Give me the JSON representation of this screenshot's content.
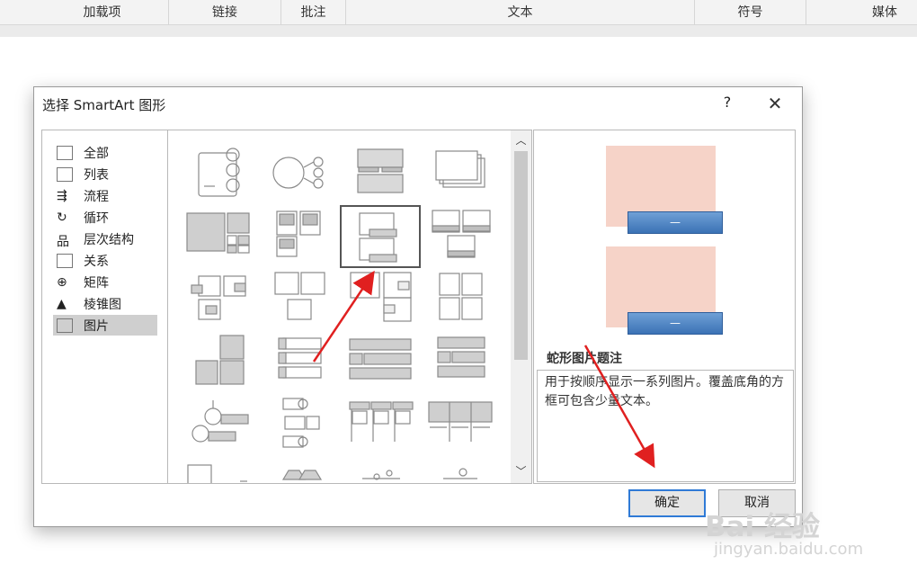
{
  "ribbon": {
    "groups": [
      "加载项",
      "链接",
      "批注",
      "文本",
      "符号",
      "媒体"
    ]
  },
  "dialog": {
    "title": "选择 SmartArt 图形",
    "help": "?",
    "close": "✕",
    "categories": [
      {
        "label": "全部",
        "icon": "all-icon"
      },
      {
        "label": "列表",
        "icon": "list-icon"
      },
      {
        "label": "流程",
        "icon": "process-icon"
      },
      {
        "label": "循环",
        "icon": "cycle-icon"
      },
      {
        "label": "层次结构",
        "icon": "hierarchy-icon"
      },
      {
        "label": "关系",
        "icon": "relationship-icon"
      },
      {
        "label": "矩阵",
        "icon": "matrix-icon"
      },
      {
        "label": "棱锥图",
        "icon": "pyramid-icon"
      },
      {
        "label": "图片",
        "icon": "picture-icon"
      }
    ],
    "selected_category": "图片",
    "preview": {
      "bar_text": "—",
      "title": "蛇形图片题注",
      "description": "用于按顺序显示一系列图片。覆盖底角的方框可包含少量文本。"
    },
    "buttons": {
      "ok": "确定",
      "cancel": "取消"
    }
  },
  "watermark": {
    "main": "Bai 经验",
    "sub": "jingyan.baidu.com"
  },
  "colors": {
    "accent": "#2f7ad6",
    "preview_image": "#f6d3c8",
    "preview_bar": "#3b72b5",
    "arrow": "#e02020"
  }
}
